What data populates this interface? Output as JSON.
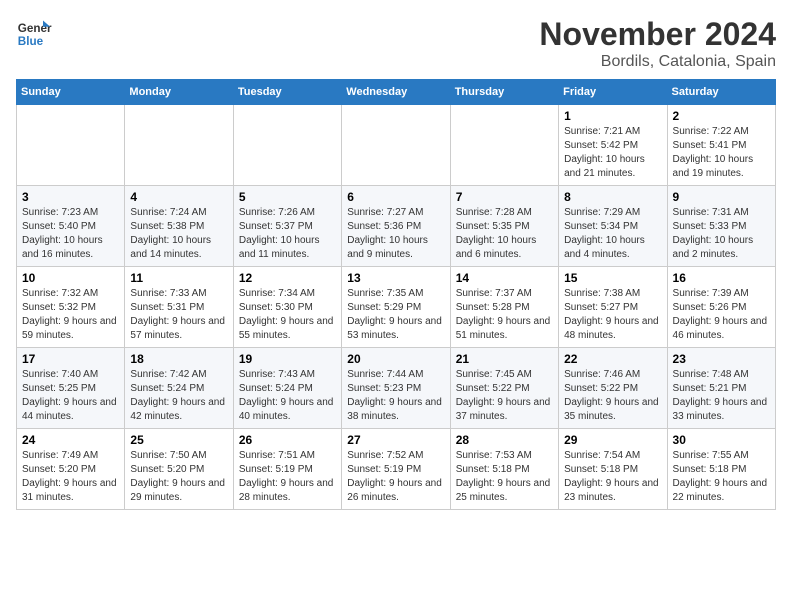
{
  "logo": {
    "name1": "General",
    "name2": "Blue"
  },
  "header": {
    "month": "November 2024",
    "location": "Bordils, Catalonia, Spain"
  },
  "days_of_week": [
    "Sunday",
    "Monday",
    "Tuesday",
    "Wednesday",
    "Thursday",
    "Friday",
    "Saturday"
  ],
  "weeks": [
    [
      {
        "day": "",
        "info": ""
      },
      {
        "day": "",
        "info": ""
      },
      {
        "day": "",
        "info": ""
      },
      {
        "day": "",
        "info": ""
      },
      {
        "day": "",
        "info": ""
      },
      {
        "day": "1",
        "info": "Sunrise: 7:21 AM\nSunset: 5:42 PM\nDaylight: 10 hours and 21 minutes."
      },
      {
        "day": "2",
        "info": "Sunrise: 7:22 AM\nSunset: 5:41 PM\nDaylight: 10 hours and 19 minutes."
      }
    ],
    [
      {
        "day": "3",
        "info": "Sunrise: 7:23 AM\nSunset: 5:40 PM\nDaylight: 10 hours and 16 minutes."
      },
      {
        "day": "4",
        "info": "Sunrise: 7:24 AM\nSunset: 5:38 PM\nDaylight: 10 hours and 14 minutes."
      },
      {
        "day": "5",
        "info": "Sunrise: 7:26 AM\nSunset: 5:37 PM\nDaylight: 10 hours and 11 minutes."
      },
      {
        "day": "6",
        "info": "Sunrise: 7:27 AM\nSunset: 5:36 PM\nDaylight: 10 hours and 9 minutes."
      },
      {
        "day": "7",
        "info": "Sunrise: 7:28 AM\nSunset: 5:35 PM\nDaylight: 10 hours and 6 minutes."
      },
      {
        "day": "8",
        "info": "Sunrise: 7:29 AM\nSunset: 5:34 PM\nDaylight: 10 hours and 4 minutes."
      },
      {
        "day": "9",
        "info": "Sunrise: 7:31 AM\nSunset: 5:33 PM\nDaylight: 10 hours and 2 minutes."
      }
    ],
    [
      {
        "day": "10",
        "info": "Sunrise: 7:32 AM\nSunset: 5:32 PM\nDaylight: 9 hours and 59 minutes."
      },
      {
        "day": "11",
        "info": "Sunrise: 7:33 AM\nSunset: 5:31 PM\nDaylight: 9 hours and 57 minutes."
      },
      {
        "day": "12",
        "info": "Sunrise: 7:34 AM\nSunset: 5:30 PM\nDaylight: 9 hours and 55 minutes."
      },
      {
        "day": "13",
        "info": "Sunrise: 7:35 AM\nSunset: 5:29 PM\nDaylight: 9 hours and 53 minutes."
      },
      {
        "day": "14",
        "info": "Sunrise: 7:37 AM\nSunset: 5:28 PM\nDaylight: 9 hours and 51 minutes."
      },
      {
        "day": "15",
        "info": "Sunrise: 7:38 AM\nSunset: 5:27 PM\nDaylight: 9 hours and 48 minutes."
      },
      {
        "day": "16",
        "info": "Sunrise: 7:39 AM\nSunset: 5:26 PM\nDaylight: 9 hours and 46 minutes."
      }
    ],
    [
      {
        "day": "17",
        "info": "Sunrise: 7:40 AM\nSunset: 5:25 PM\nDaylight: 9 hours and 44 minutes."
      },
      {
        "day": "18",
        "info": "Sunrise: 7:42 AM\nSunset: 5:24 PM\nDaylight: 9 hours and 42 minutes."
      },
      {
        "day": "19",
        "info": "Sunrise: 7:43 AM\nSunset: 5:24 PM\nDaylight: 9 hours and 40 minutes."
      },
      {
        "day": "20",
        "info": "Sunrise: 7:44 AM\nSunset: 5:23 PM\nDaylight: 9 hours and 38 minutes."
      },
      {
        "day": "21",
        "info": "Sunrise: 7:45 AM\nSunset: 5:22 PM\nDaylight: 9 hours and 37 minutes."
      },
      {
        "day": "22",
        "info": "Sunrise: 7:46 AM\nSunset: 5:22 PM\nDaylight: 9 hours and 35 minutes."
      },
      {
        "day": "23",
        "info": "Sunrise: 7:48 AM\nSunset: 5:21 PM\nDaylight: 9 hours and 33 minutes."
      }
    ],
    [
      {
        "day": "24",
        "info": "Sunrise: 7:49 AM\nSunset: 5:20 PM\nDaylight: 9 hours and 31 minutes."
      },
      {
        "day": "25",
        "info": "Sunrise: 7:50 AM\nSunset: 5:20 PM\nDaylight: 9 hours and 29 minutes."
      },
      {
        "day": "26",
        "info": "Sunrise: 7:51 AM\nSunset: 5:19 PM\nDaylight: 9 hours and 28 minutes."
      },
      {
        "day": "27",
        "info": "Sunrise: 7:52 AM\nSunset: 5:19 PM\nDaylight: 9 hours and 26 minutes."
      },
      {
        "day": "28",
        "info": "Sunrise: 7:53 AM\nSunset: 5:18 PM\nDaylight: 9 hours and 25 minutes."
      },
      {
        "day": "29",
        "info": "Sunrise: 7:54 AM\nSunset: 5:18 PM\nDaylight: 9 hours and 23 minutes."
      },
      {
        "day": "30",
        "info": "Sunrise: 7:55 AM\nSunset: 5:18 PM\nDaylight: 9 hours and 22 minutes."
      }
    ]
  ]
}
